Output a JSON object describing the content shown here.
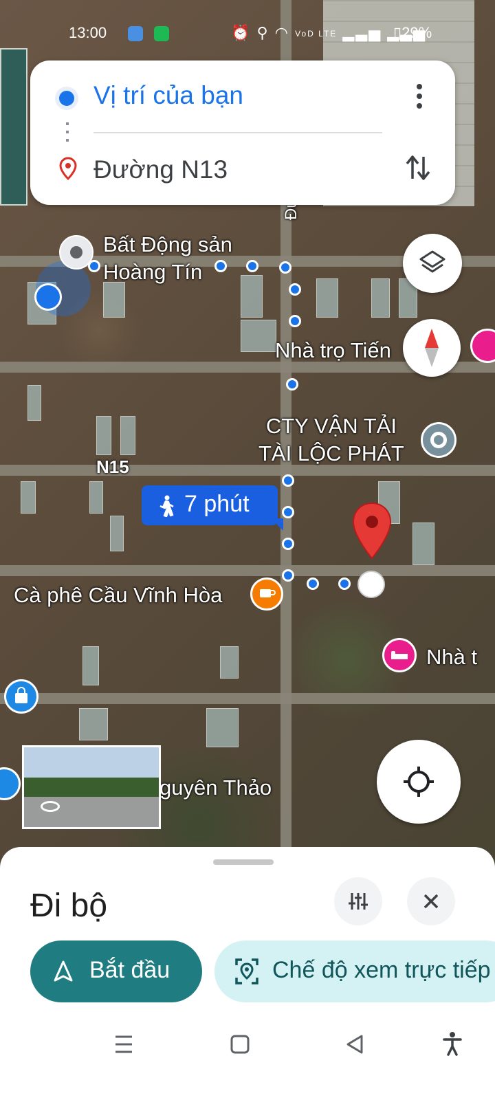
{
  "status_bar": {
    "time": "13:00",
    "network": "VoD LTE",
    "battery": "29%"
  },
  "directions_card": {
    "origin": "Vị trí của bạn",
    "destination": "Đường N13"
  },
  "map": {
    "labels": {
      "real_estate": "Bất Động sản\nHoàng Tín",
      "guesthouse": "Nhà trọ Tiến",
      "transport_company": "CTY VẬN TẢI\nTÀI LỘC PHÁT",
      "road_n15": "N15",
      "road_duong": "Đườ",
      "cafe": "Cà phê Cầu Vĩnh Hòa",
      "guesthouse2": "Nhà t",
      "place": "guyên Thảo"
    },
    "eta": "7 phút"
  },
  "sheet": {
    "title": "Đi bộ",
    "start_label": "Bắt đầu",
    "live_view_label": "Chế độ xem trực tiếp"
  },
  "colors": {
    "route_blue": "#1a73e8",
    "start_button": "#1f7c80",
    "live_button_bg": "#d4f1f4",
    "pin_red": "#e53935"
  }
}
